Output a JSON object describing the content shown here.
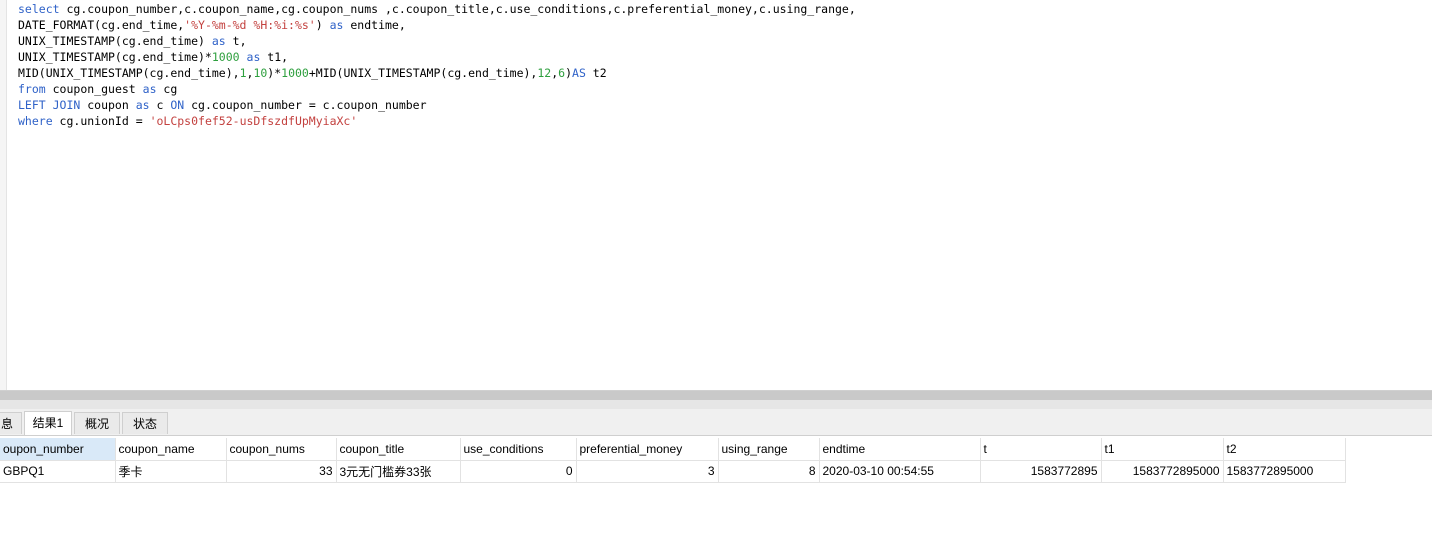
{
  "sql": {
    "lines": [
      "select cg.coupon_number,c.coupon_name,cg.coupon_nums ,c.coupon_title,c.use_conditions,c.preferential_money,c.using_range,",
      "DATE_FORMAT(cg.end_time,'%Y-%m-%d %H:%i:%s') as endtime,",
      "UNIX_TIMESTAMP(cg.end_time) as t,",
      "UNIX_TIMESTAMP(cg.end_time)*1000 as t1,",
      "MID(UNIX_TIMESTAMP(cg.end_time),1,10)*1000+MID(UNIX_TIMESTAMP(cg.end_time),12,6)AS t2",
      "from coupon_guest as cg",
      "LEFT JOIN coupon as c ON cg.coupon_number = c.coupon_number",
      "where cg.unionId = 'oLCps0fef52-usDfszdfUpMyiaXc'"
    ],
    "gutter": [
      "",
      "",
      "",
      "",
      "",
      "",
      "",
      "",
      "",
      ""
    ]
  },
  "result_tabs": [
    "息",
    "结果1",
    "概况",
    "状态"
  ],
  "active_tab": "结果1",
  "grid": {
    "columns": [
      "oupon_number",
      "coupon_name",
      "coupon_nums",
      "coupon_title",
      "use_conditions",
      "preferential_money",
      "using_range",
      "endtime",
      "t",
      "t1",
      "t2"
    ],
    "rows": [
      [
        "GBPQ1",
        "季卡",
        "33",
        "3元无门槛券33张",
        "0",
        "3",
        "8",
        "2020-03-10 00:54:55",
        "1583772895",
        "1583772895000",
        "1583772895000"
      ]
    ]
  }
}
